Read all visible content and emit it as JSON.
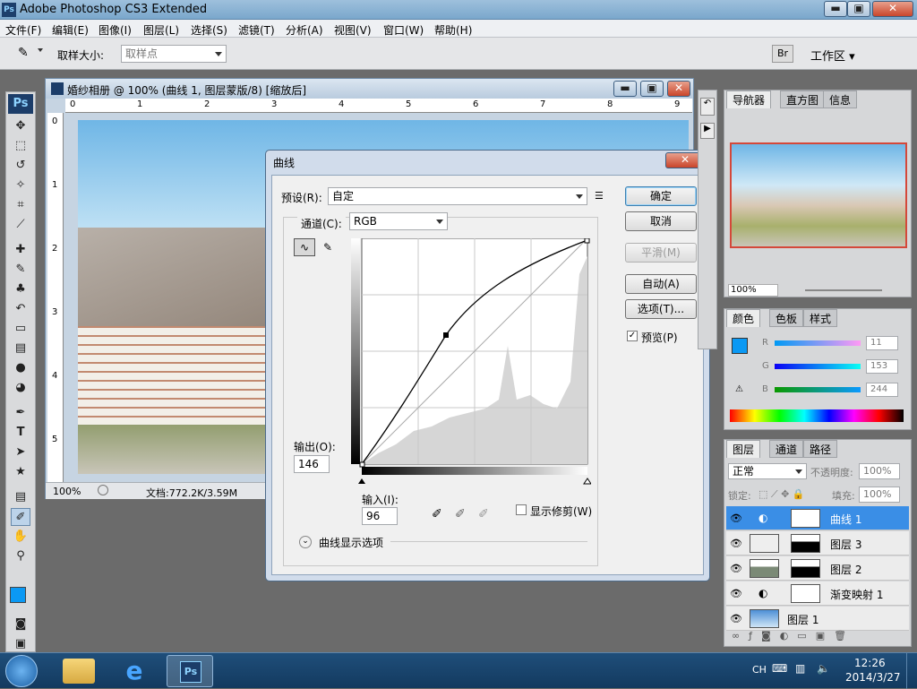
{
  "window": {
    "title": "Adobe Photoshop CS3 Extended",
    "app_icon": "Ps"
  },
  "menu": [
    "文件(F)",
    "编辑(E)",
    "图像(I)",
    "图层(L)",
    "选择(S)",
    "滤镜(T)",
    "分析(A)",
    "视图(V)",
    "窗口(W)",
    "帮助(H)"
  ],
  "options": {
    "sample_size_label": "取样大小:",
    "sample_size_value": "取样点",
    "workspace": "工作区 ▾"
  },
  "toolbox": {
    "logo": "Ps"
  },
  "document": {
    "title": "婚纱相册 @ 100% (曲线 1, 图层蒙版/8) [缩放后]",
    "ruler_top": [
      "0",
      "1",
      "2",
      "3",
      "4",
      "5",
      "6",
      "7",
      "8",
      "9"
    ],
    "ruler_left": [
      "0",
      "1",
      "2",
      "3",
      "4",
      "5"
    ],
    "zoom": "100%",
    "doc_size": "文档:772.2K/3.59M"
  },
  "curves": {
    "title": "曲线",
    "preset_label": "预设(R):",
    "preset_value": "自定",
    "channel_label": "通道(C):",
    "channel_value": "RGB",
    "output_label": "输出(O):",
    "output_value": "146",
    "input_label": "输入(I):",
    "input_value": "96",
    "show_clipping": "显示修剪(W)",
    "display_options": "曲线显示选项",
    "buttons": {
      "ok": "确定",
      "cancel": "取消",
      "smooth": "平滑(M)",
      "auto": "自动(A)",
      "options": "选项(T)..."
    },
    "preview_label": "预览(P)",
    "preview_checked": true
  },
  "navigator": {
    "tabs": [
      "导航器",
      "直方图",
      "信息"
    ],
    "zoom": "100%"
  },
  "color": {
    "tabs": [
      "颜色",
      "色板",
      "样式"
    ],
    "r_label": "R",
    "g_label": "G",
    "b_label": "B",
    "r": "11",
    "g": "153",
    "b": "244",
    "fg": "#0b99f4"
  },
  "layers": {
    "tabs": [
      "图层",
      "通道",
      "路径"
    ],
    "blend": "正常",
    "opacity_label": "不透明度:",
    "opacity": "100%",
    "lock_label": "锁定:",
    "fill_label": "填充:",
    "fill": "100%",
    "items": [
      {
        "name": "曲线 1",
        "selected": true
      },
      {
        "name": "图层 3",
        "selected": false
      },
      {
        "name": "图层 2",
        "selected": false
      },
      {
        "name": "渐变映射 1",
        "selected": false
      },
      {
        "name": "图层 1",
        "selected": false
      }
    ]
  },
  "taskbar": {
    "lang": "CH",
    "time": "12:26",
    "date": "2014/3/27"
  }
}
